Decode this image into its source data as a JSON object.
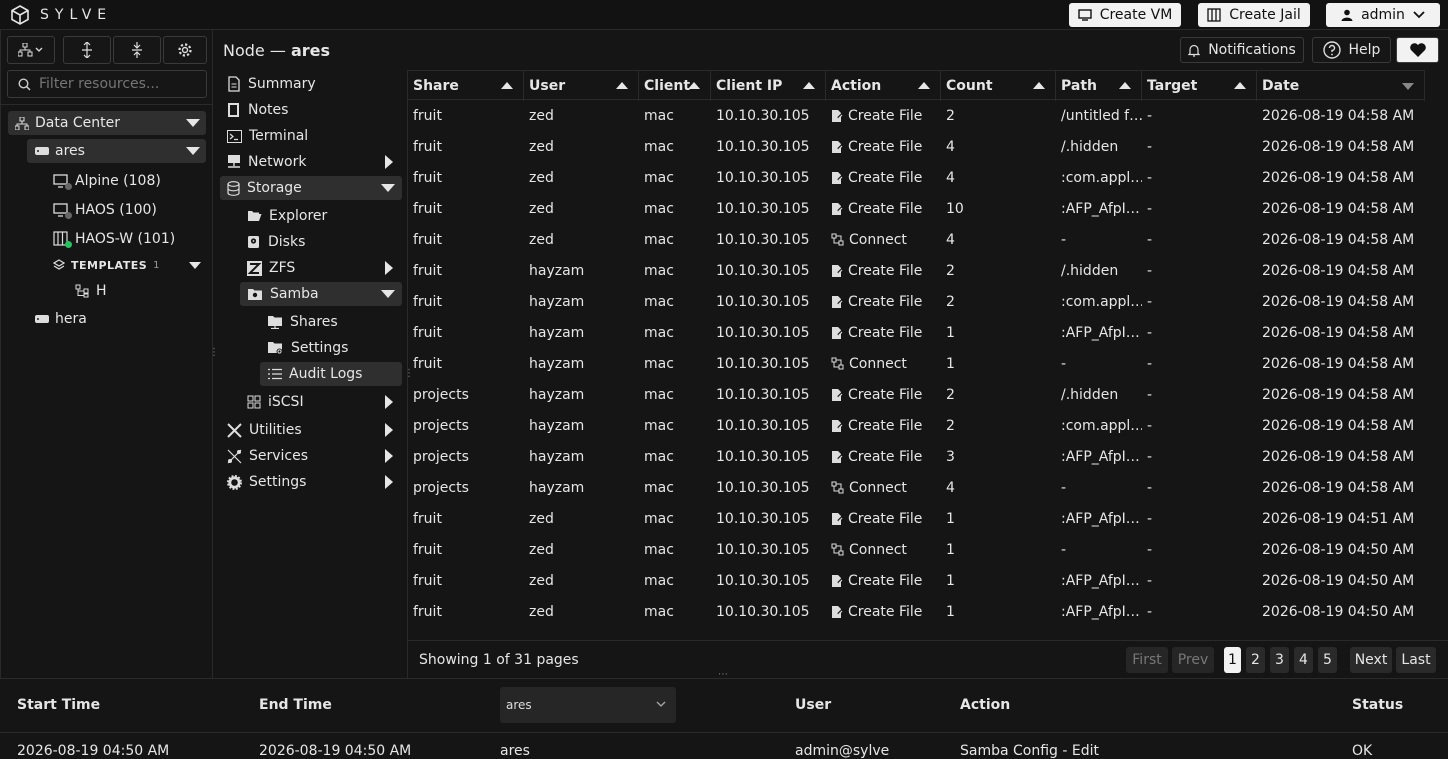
{
  "app": {
    "name": "SYLVE"
  },
  "topbar": {
    "create_vm": "Create VM",
    "create_jail": "Create Jail",
    "user": "admin"
  },
  "sidebar": {
    "filter_placeholder": "Filter resources...",
    "datacenter": "Data Center",
    "node": "ares",
    "vms": [
      "Alpine (108)",
      "HAOS (100)",
      "HAOS-W (101)"
    ],
    "templates_label": "TEMPLATES",
    "templates_count": "1",
    "template_item": "H",
    "other_node": "hera"
  },
  "header": {
    "prefix": "Node — ",
    "node": "ares",
    "notifications": "Notifications",
    "help": "Help"
  },
  "menu": {
    "summary": "Summary",
    "notes": "Notes",
    "terminal": "Terminal",
    "network": "Network",
    "storage": "Storage",
    "explorer": "Explorer",
    "disks": "Disks",
    "zfs": "ZFS",
    "samba": "Samba",
    "shares": "Shares",
    "settings_sub": "Settings",
    "audit_logs": "Audit Logs",
    "iscsi": "iSCSI",
    "utilities": "Utilities",
    "services": "Services",
    "settings": "Settings"
  },
  "table": {
    "columns": [
      "Share",
      "User",
      "Client",
      "Client IP",
      "Action",
      "Count",
      "Path",
      "Target",
      "Date"
    ],
    "rows": [
      [
        "fruit",
        "zed",
        "mac",
        "10.10.30.105",
        "Create File",
        "2",
        "/untitled f…",
        "-",
        "2026-08-19 04:58 AM"
      ],
      [
        "fruit",
        "zed",
        "mac",
        "10.10.30.105",
        "Create File",
        "4",
        "/.hidden",
        "-",
        "2026-08-19 04:58 AM"
      ],
      [
        "fruit",
        "zed",
        "mac",
        "10.10.30.105",
        "Create File",
        "4",
        ":com.appl…",
        "-",
        "2026-08-19 04:58 AM"
      ],
      [
        "fruit",
        "zed",
        "mac",
        "10.10.30.105",
        "Create File",
        "10",
        ":AFP_AfpI…",
        "-",
        "2026-08-19 04:58 AM"
      ],
      [
        "fruit",
        "zed",
        "mac",
        "10.10.30.105",
        "Connect",
        "4",
        "-",
        "-",
        "2026-08-19 04:58 AM"
      ],
      [
        "fruit",
        "hayzam",
        "mac",
        "10.10.30.105",
        "Create File",
        "2",
        "/.hidden",
        "-",
        "2026-08-19 04:58 AM"
      ],
      [
        "fruit",
        "hayzam",
        "mac",
        "10.10.30.105",
        "Create File",
        "2",
        ":com.appl…",
        "-",
        "2026-08-19 04:58 AM"
      ],
      [
        "fruit",
        "hayzam",
        "mac",
        "10.10.30.105",
        "Create File",
        "1",
        ":AFP_AfpI…",
        "-",
        "2026-08-19 04:58 AM"
      ],
      [
        "fruit",
        "hayzam",
        "mac",
        "10.10.30.105",
        "Connect",
        "1",
        "-",
        "-",
        "2026-08-19 04:58 AM"
      ],
      [
        "projects",
        "hayzam",
        "mac",
        "10.10.30.105",
        "Create File",
        "2",
        "/.hidden",
        "-",
        "2026-08-19 04:58 AM"
      ],
      [
        "projects",
        "hayzam",
        "mac",
        "10.10.30.105",
        "Create File",
        "2",
        ":com.appl…",
        "-",
        "2026-08-19 04:58 AM"
      ],
      [
        "projects",
        "hayzam",
        "mac",
        "10.10.30.105",
        "Create File",
        "3",
        ":AFP_AfpI…",
        "-",
        "2026-08-19 04:58 AM"
      ],
      [
        "projects",
        "hayzam",
        "mac",
        "10.10.30.105",
        "Connect",
        "4",
        "-",
        "-",
        "2026-08-19 04:58 AM"
      ],
      [
        "fruit",
        "zed",
        "mac",
        "10.10.30.105",
        "Create File",
        "1",
        ":AFP_AfpI…",
        "-",
        "2026-08-19 04:51 AM"
      ],
      [
        "fruit",
        "zed",
        "mac",
        "10.10.30.105",
        "Connect",
        "1",
        "-",
        "-",
        "2026-08-19 04:50 AM"
      ],
      [
        "fruit",
        "zed",
        "mac",
        "10.10.30.105",
        "Create File",
        "1",
        ":AFP_AfpI…",
        "-",
        "2026-08-19 04:50 AM"
      ],
      [
        "fruit",
        "zed",
        "mac",
        "10.10.30.105",
        "Create File",
        "1",
        ":AFP_AfpI…",
        "-",
        "2026-08-19 04:50 AM"
      ]
    ]
  },
  "pagination": {
    "showing": "Showing 1 of 31 pages",
    "first": "First",
    "prev": "Prev",
    "pages": [
      "1",
      "2",
      "3",
      "4",
      "5"
    ],
    "next": "Next",
    "last": "Last"
  },
  "bottom": {
    "columns": {
      "start": "Start Time",
      "end": "End Time",
      "user": "User",
      "action": "Action",
      "status": "Status"
    },
    "node_select": "ares",
    "row": {
      "start": "2026-08-19 04:50 AM",
      "end": "2026-08-19 04:50 AM",
      "node": "ares",
      "user": "admin@sylve",
      "action": "Samba Config - Edit",
      "status": "OK"
    }
  }
}
